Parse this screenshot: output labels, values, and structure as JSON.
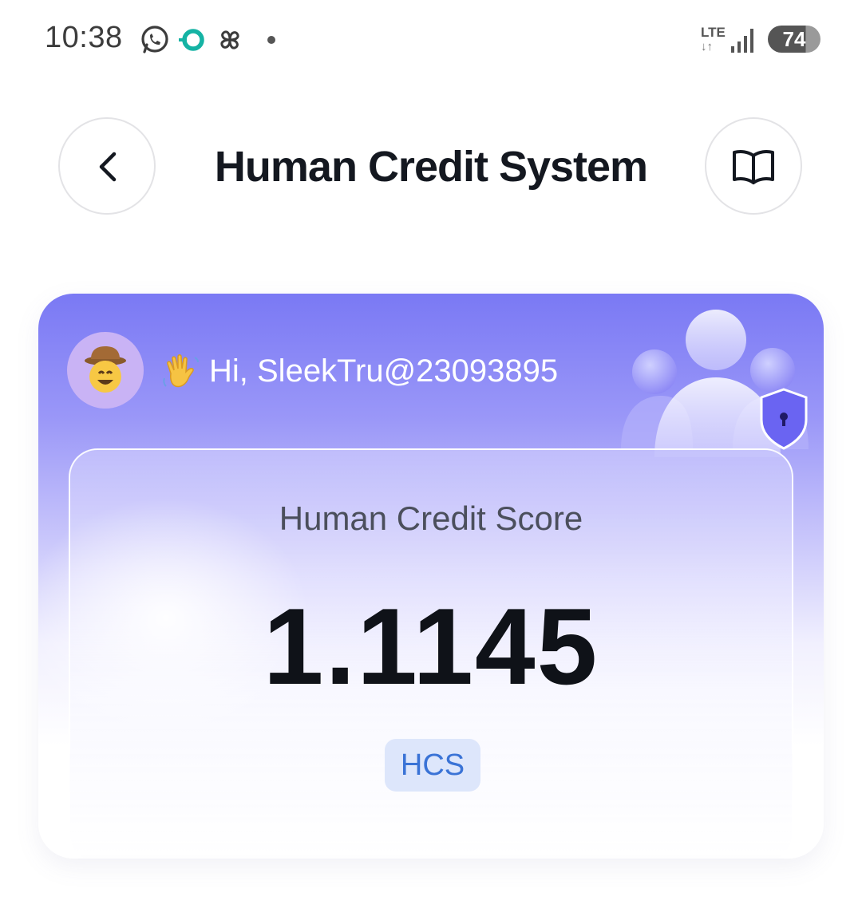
{
  "status_bar": {
    "time": "10:38",
    "network": "LTE",
    "battery": "74",
    "icons": [
      "whatsapp-icon",
      "ring-app-icon",
      "pinwheel-icon",
      "notification-dot-icon",
      "signal-icon"
    ]
  },
  "header": {
    "title": "Human Credit System",
    "back_icon": "chevron-left-icon",
    "guide_icon": "book-icon"
  },
  "card": {
    "greeting": "Hi, SleekTru@23093895",
    "greeting_emoji": "👋",
    "avatar_emoji": "🤠",
    "score_label": "Human Credit Score",
    "score_value": "1.1145",
    "unit_badge": "HCS"
  },
  "colors": {
    "card_top": "#7a79f4",
    "badge_bg": "#dde6fb",
    "badge_text": "#3a73d6",
    "title_text": "#141820"
  }
}
